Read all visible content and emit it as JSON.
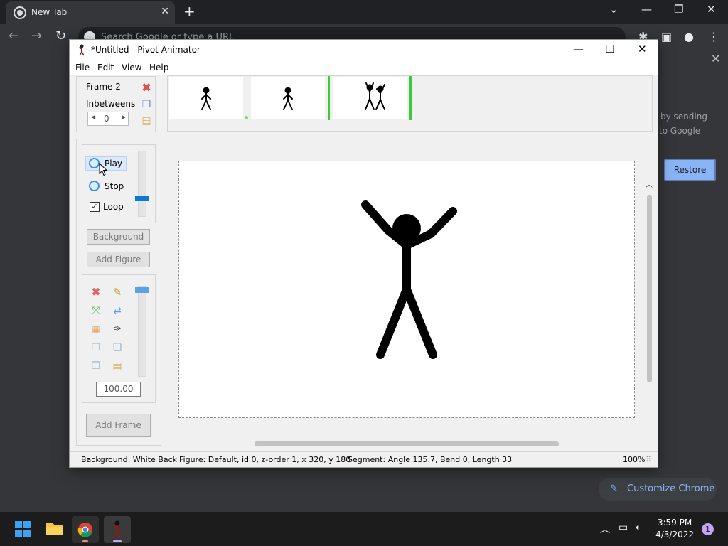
{
  "chrome": {
    "tab_title": "New Tab",
    "omnibox_placeholder": "Search Google or type a URL",
    "side_text_1": "by sending",
    "side_text_2": "to Google",
    "restore_label": "Restore",
    "customize_label": "Customize Chrome"
  },
  "window": {
    "title": "*Untitled - Pivot Animator"
  },
  "menu": {
    "file": "File",
    "edit": "Edit",
    "view": "View",
    "help": "Help"
  },
  "frame_panel": {
    "frame_label": "Frame 2",
    "inbetweens_label": "Inbetweens",
    "inbetweens_value": "0"
  },
  "playback": {
    "play_label": "Play",
    "stop_label": "Stop",
    "loop_label": "Loop",
    "loop_checked": true
  },
  "buttons": {
    "background": "Background",
    "add_figure": "Add Figure",
    "add_frame": "Add Frame"
  },
  "tools": {
    "scale_value": "100.00"
  },
  "statusbar": {
    "background": "Background: White Back",
    "figure": "Figure: Default,  id 0,  z-order 1,  x 320, y 180",
    "segment": "Segment: Angle 135.7,  Bend 0,  Length 33",
    "zoom": "100%"
  },
  "taskbar": {
    "time": "3:59 PM",
    "date": "4/3/2022",
    "notifications": "1"
  },
  "colors": {
    "frame_marker": "#3cc93c",
    "accent": "#0a7ad4",
    "chrome_blue": "#8ab4f8"
  }
}
